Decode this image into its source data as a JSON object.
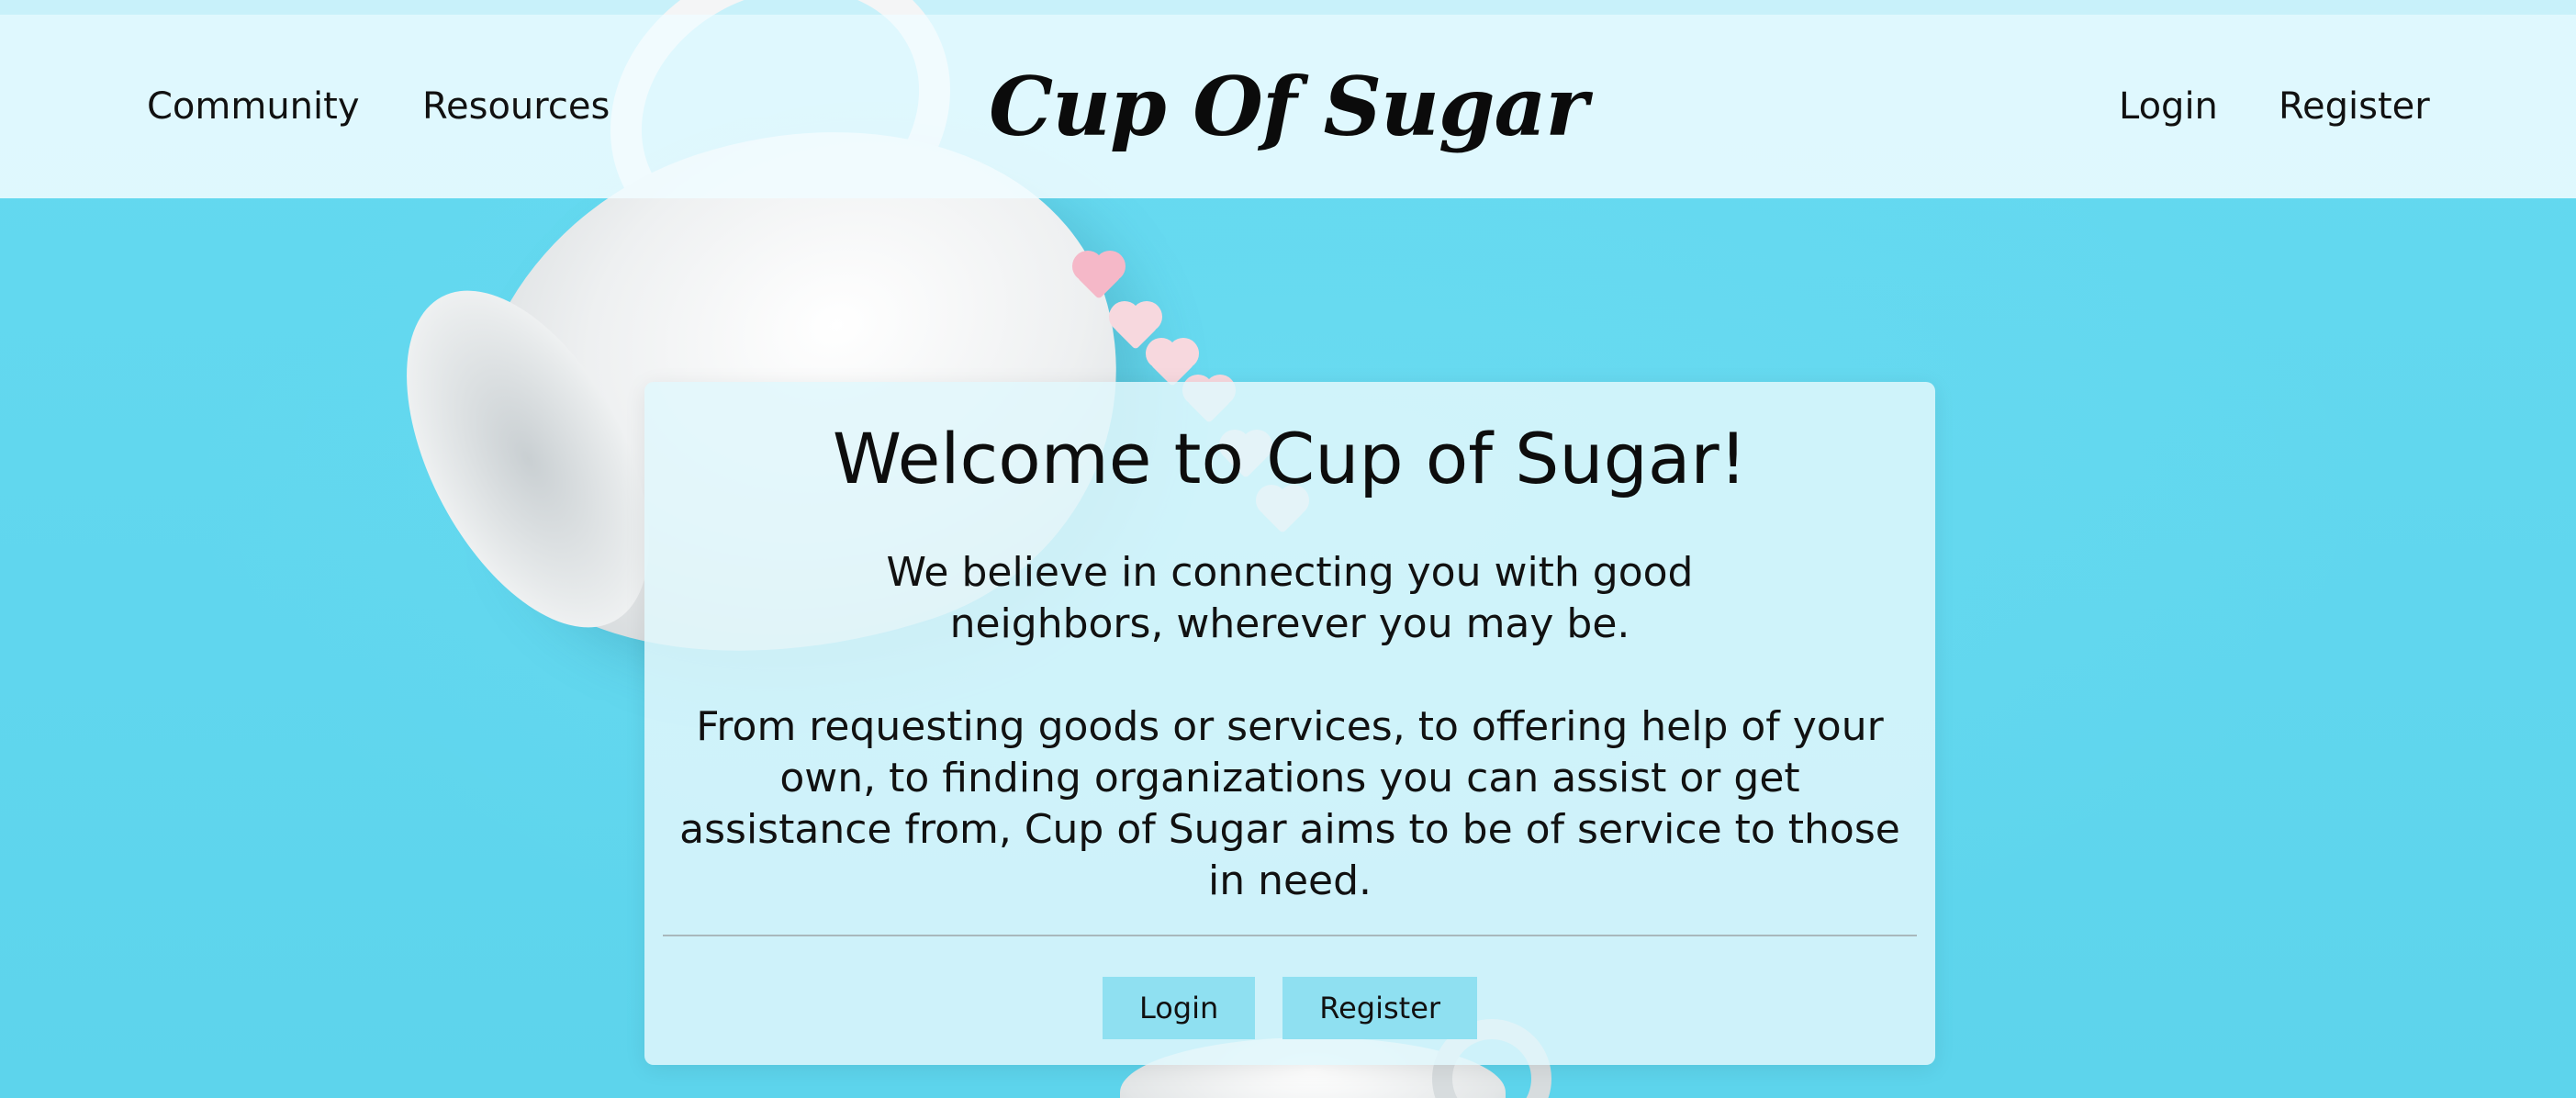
{
  "header": {
    "nav_left": [
      "Community",
      "Resources"
    ],
    "brand": "Cup Of Sugar",
    "nav_right": [
      "Login",
      "Register"
    ]
  },
  "welcome": {
    "title": "Welcome to Cup of Sugar!",
    "paragraph_1": "We believe in connecting you with good neighbors, wherever you may be.",
    "paragraph_2": "From requesting goods or services, to offering help of your own, to finding organizations you can assist or get assistance from, Cup of Sugar aims to be of service to those in need.",
    "login_label": "Login",
    "register_label": "Register"
  },
  "colors": {
    "background": "#5fd6ee",
    "header_bg": "#f0fcff",
    "button_bg": "#8fe0f1"
  }
}
